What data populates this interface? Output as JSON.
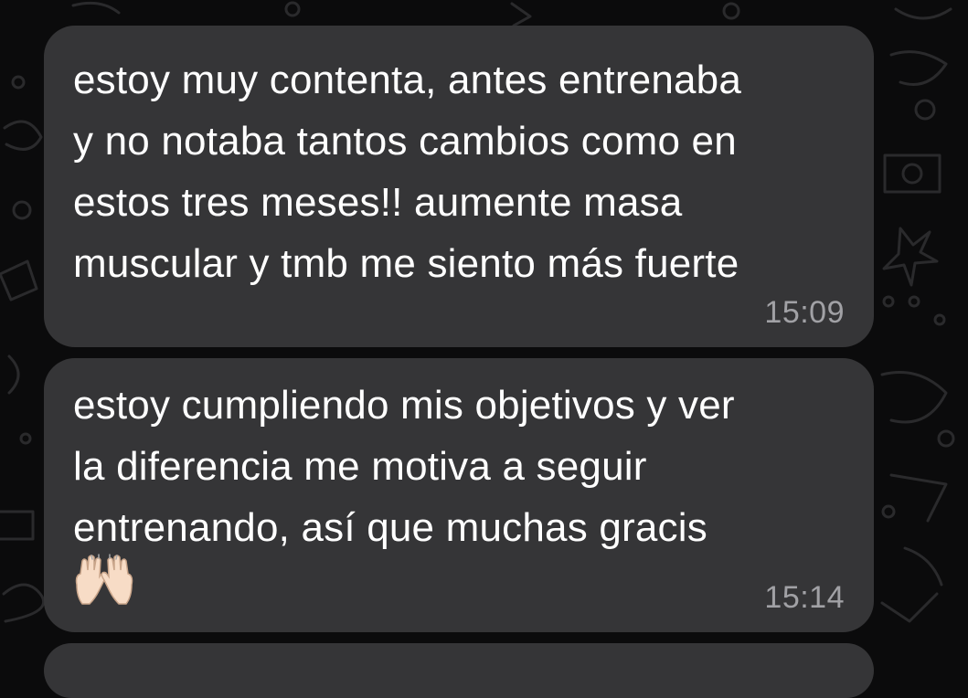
{
  "conversation": {
    "messages": [
      {
        "text": "estoy muy contenta, antes entrenaba\ny no notaba tantos cambios como en\nestos tres meses!! aumente masa\nmuscular y tmb me siento más fuerte",
        "time": "15:09"
      },
      {
        "text": "estoy cumpliendo mis objetivos y ver\nla diferencia me motiva a seguir\nentrenando, así que muchas gracis",
        "emoji": "raising-hands-icon",
        "time": "15:14"
      }
    ]
  },
  "theme": {
    "background": "#0b0b0c",
    "bubble": "#353537",
    "text": "#ffffff",
    "timestamp": "#a1a1a5"
  }
}
